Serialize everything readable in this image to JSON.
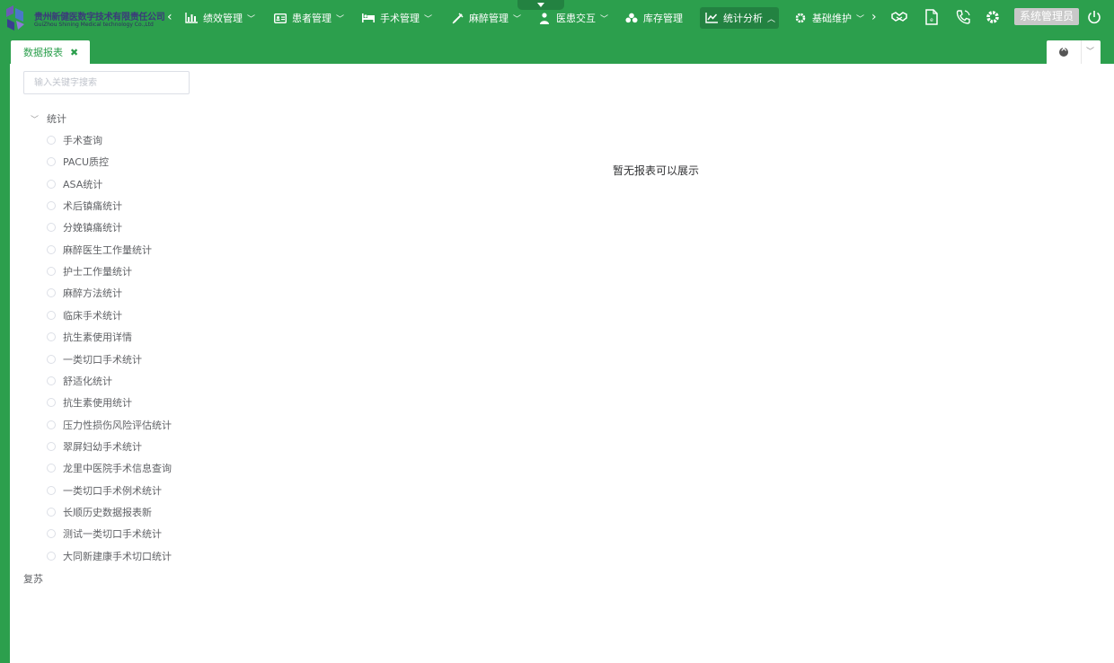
{
  "brand": {
    "name_cn": "贵州新健医数字技术有限责任公司",
    "name_en": "GuiZhou Shining Medical technology Co.,Ltd"
  },
  "nav": {
    "items": [
      {
        "label": "绩效管理",
        "icon": "bar-chart-icon"
      },
      {
        "label": "患者管理",
        "icon": "id-card-icon"
      },
      {
        "label": "手术管理",
        "icon": "bed-icon"
      },
      {
        "label": "麻醉管理",
        "icon": "syringe-icon"
      },
      {
        "label": "医患交互",
        "icon": "doctor-icon"
      },
      {
        "label": "库存管理",
        "icon": "boxes-icon"
      },
      {
        "label": "统计分析",
        "icon": "line-chart-icon",
        "active": true
      },
      {
        "label": "基础维护",
        "icon": "gear-icon"
      }
    ],
    "tools": [
      "handshake-icon",
      "document-icon",
      "phone-icon",
      "settings-icon"
    ],
    "user": "系统管理员"
  },
  "tabs": {
    "active": "数据报表"
  },
  "sidebar": {
    "search_placeholder": "输入关键字搜索",
    "root": "统计",
    "children": [
      "手术查询",
      "PACU质控",
      "ASA统计",
      "术后镇痛统计",
      "分娩镇痛统计",
      "麻醉医生工作量统计",
      "护士工作量统计",
      "麻醉方法统计",
      "临床手术统计",
      "抗生素使用详情",
      "一类切口手术统计",
      "舒适化统计",
      "抗生素使用统计",
      "压力性损伤风险评估统计",
      "翠屏妇幼手术统计",
      "龙里中医院手术信息查询",
      "一类切口手术例术统计",
      "长顺历史数据报表新",
      "测试一类切口手术统计",
      "大同新建康手术切口统计"
    ],
    "group2": "复苏"
  },
  "main": {
    "empty_message": "暂无报表可以展示"
  },
  "colors": {
    "primary": "#2c9f4d",
    "primary_dark": "#238241"
  }
}
